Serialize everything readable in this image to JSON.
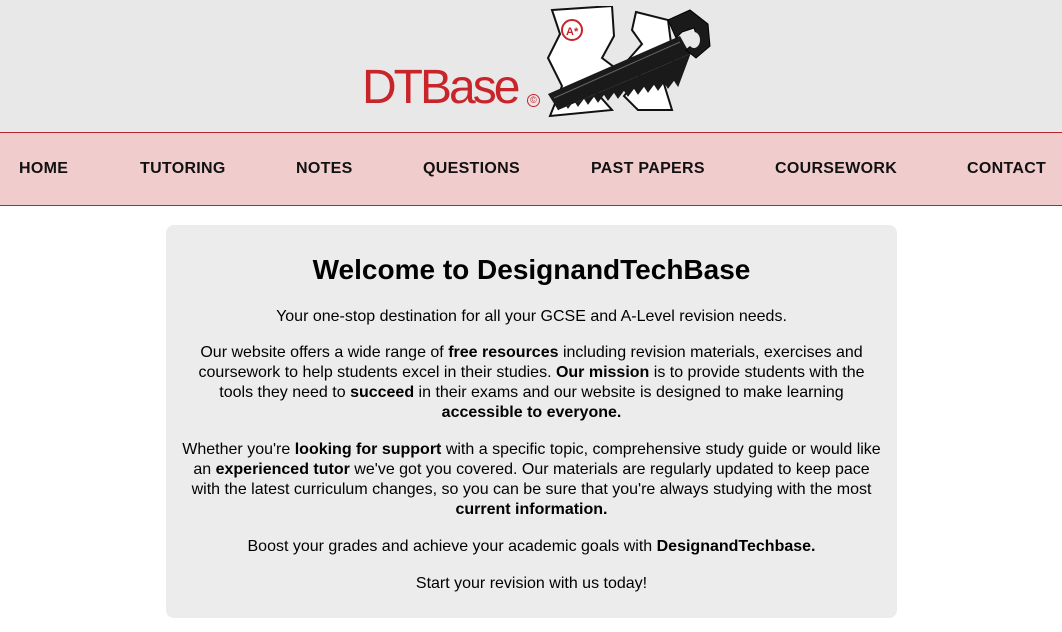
{
  "brand": {
    "logo_text": "DTBase",
    "copyright_mark": "©",
    "badge_text": "A*",
    "colors": {
      "brand_red": "#c8252b",
      "nav_bg": "#f0cccd",
      "header_bg": "#e8e8e8",
      "card_bg": "#ececec"
    }
  },
  "nav": {
    "items": [
      "HOME",
      "TUTORING",
      "NOTES",
      "QUESTIONS",
      "PAST PAPERS",
      "COURSEWORK",
      "CONTACT"
    ]
  },
  "main": {
    "title": "Welcome to DesignandTechBase",
    "intro": "Your one-stop destination for all your GCSE and A-Level revision needs.",
    "p2": {
      "a": "Our website offers a wide range of ",
      "b": "free resources",
      "c": " including revision materials, exercises and coursework to help students excel in their studies. ",
      "d": "Our mission",
      "e": " is to provide students with the tools they need to ",
      "f": "succeed",
      "g": " in their exams and our website is designed to make learning ",
      "h": "accessible to everyone."
    },
    "p3": {
      "a": "Whether you're ",
      "b": "looking for support",
      "c": " with a specific topic, comprehensive study guide or would like an ",
      "d": "experienced tutor",
      "e": " we've got you covered. Our materials are regularly updated to keep pace with the latest curriculum changes, so you can be sure that you're always studying with the most ",
      "f": "current information."
    },
    "p4": {
      "a": "Boost your grades and achieve your academic goals with ",
      "b": "DesignandTechbase."
    },
    "closing": "Start your revision with us today!"
  }
}
